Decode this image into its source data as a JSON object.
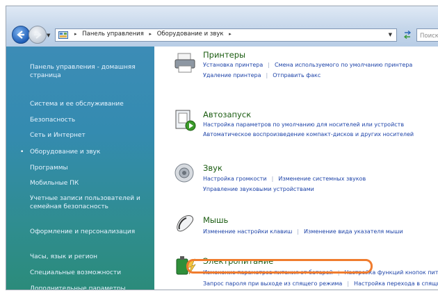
{
  "address_bar": {
    "crumbs": [
      "Панель управления",
      "Оборудование и звук"
    ],
    "search_placeholder": "Поиск"
  },
  "sidebar": {
    "items": [
      {
        "label": "Панель управления - домашняя страница"
      },
      {
        "label": "Система и ее обслуживание"
      },
      {
        "label": "Безопасность"
      },
      {
        "label": "Сеть и Интернет"
      },
      {
        "label": "Оборудование и звук",
        "active": true
      },
      {
        "label": "Программы"
      },
      {
        "label": "Мобильные ПК"
      },
      {
        "label": "Учетные записи пользователей и семейная безопасность"
      },
      {
        "label": "Оформление и персонализация"
      },
      {
        "label": "Часы, язык и регион"
      },
      {
        "label": "Специальные возможности"
      },
      {
        "label": "Дополнительные параметры"
      }
    ]
  },
  "categories": [
    {
      "title": "Принтеры",
      "icon": "printer-icon",
      "lines": [
        [
          "Установка принтера",
          "Смена используемого по умолчанию принтера"
        ],
        [
          "Удаление принтера",
          "Отправить факс"
        ]
      ]
    },
    {
      "title": "Автозапуск",
      "icon": "autoplay-icon",
      "lines": [
        [
          "Настройка параметров по умолчанию для носителей или устройств"
        ],
        [
          "Автоматическое воспроизведение компакт-дисков и других носителей"
        ]
      ]
    },
    {
      "title": "Звук",
      "icon": "speaker-icon",
      "lines": [
        [
          "Настройка громкости",
          "Изменение системных звуков"
        ],
        [
          "Управление звуковыми устройствами"
        ]
      ]
    },
    {
      "title": "Мышь",
      "icon": "mouse-icon",
      "lines": [
        [
          "Изменение настройки клавиш",
          "Изменение вида указателя мыши"
        ]
      ]
    },
    {
      "title": "Электропитание",
      "icon": "power-icon",
      "lines": [
        [
          "Изменение параметров питания от батарей",
          "Настройка функций кнопок питания"
        ],
        [
          "Запрос пароля при выходе из спящего режима",
          "Настройка перехода в спящий режим"
        ]
      ]
    }
  ],
  "highlight_color": "#f07c2e"
}
